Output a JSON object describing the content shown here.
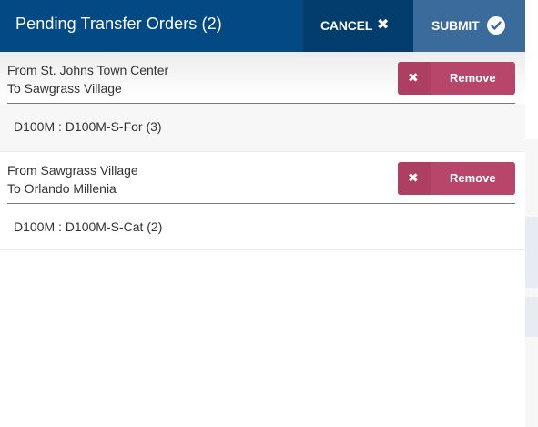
{
  "header": {
    "title": "Pending Transfer Orders (2)",
    "cancel_label": "CANCEL",
    "cancel_icon": "close-icon",
    "submit_label": "SUBMIT",
    "submit_icon": "check-icon"
  },
  "orders": [
    {
      "from": "From St. Johns Town Center",
      "to": "To Sawgrass Village",
      "remove_label": "Remove",
      "items": [
        "D100M : D100M-S-For (3)"
      ]
    },
    {
      "from": "From Sawgrass Village",
      "to": "To Orlando Millenia",
      "remove_label": "Remove",
      "items": [
        "D100M : D100M-S-Cat (2)"
      ]
    }
  ],
  "colors": {
    "header_bg": "#034a84",
    "cancel_bg": "#023d6e",
    "submit_bg": "#3a6b9b",
    "remove_bg": "#b8456a",
    "text": "#333333"
  }
}
